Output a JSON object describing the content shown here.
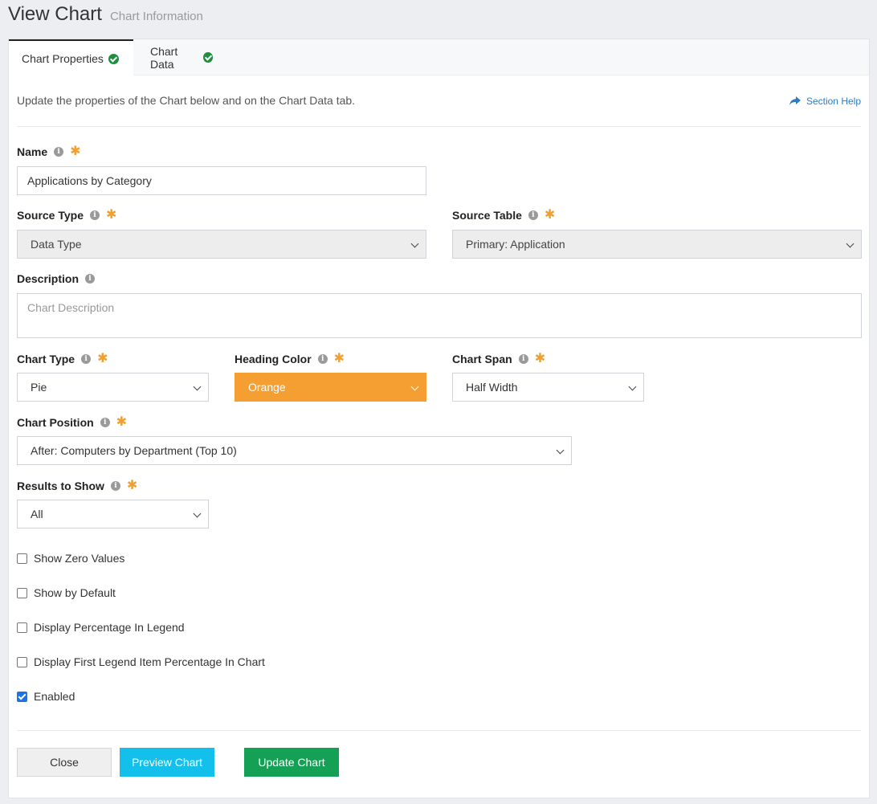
{
  "header": {
    "title": "View Chart",
    "subtitle": "Chart Information"
  },
  "tabs": [
    {
      "label": "Chart Properties",
      "active": true
    },
    {
      "label": "Chart Data",
      "active": false
    }
  ],
  "intro": "Update the properties of the Chart below and on the Chart Data tab.",
  "section_help": "Section Help",
  "fields": {
    "name": {
      "label": "Name",
      "value": "Applications by Category"
    },
    "source_type": {
      "label": "Source Type",
      "value": "Data Type"
    },
    "source_table": {
      "label": "Source Table",
      "value": "Primary: Application"
    },
    "description": {
      "label": "Description",
      "placeholder": "Chart Description"
    },
    "chart_type": {
      "label": "Chart Type",
      "value": "Pie"
    },
    "heading_color": {
      "label": "Heading Color",
      "value": "Orange",
      "color": "#f59f32"
    },
    "chart_span": {
      "label": "Chart Span",
      "value": "Half Width"
    },
    "chart_position": {
      "label": "Chart Position",
      "value": "After: Computers by Department (Top 10)"
    },
    "results_to_show": {
      "label": "Results to Show",
      "value": "All"
    }
  },
  "checkboxes": [
    {
      "label": "Show Zero Values",
      "checked": false
    },
    {
      "label": "Show by Default",
      "checked": false
    },
    {
      "label": "Display Percentage In Legend",
      "checked": false
    },
    {
      "label": "Display First Legend Item Percentage In Chart",
      "checked": false
    },
    {
      "label": "Enabled",
      "checked": true
    }
  ],
  "buttons": {
    "close": "Close",
    "preview": "Preview Chart",
    "update": "Update Chart"
  },
  "colors": {
    "accent_green": "#14a155",
    "accent_cyan": "#13c0ec",
    "required": "#f0a030",
    "link": "#2a7cc7"
  }
}
